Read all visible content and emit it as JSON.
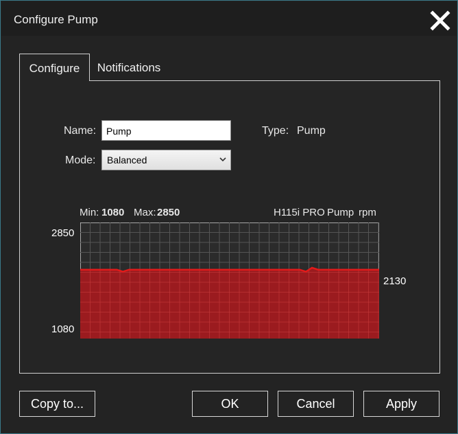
{
  "window": {
    "title": "Configure Pump"
  },
  "tabs": [
    {
      "label": "Configure",
      "active": true
    },
    {
      "label": "Notifications",
      "active": false
    }
  ],
  "form": {
    "name_label": "Name:",
    "name_value": "Pump",
    "mode_label": "Mode:",
    "mode_value": "Balanced",
    "type_label": "Type:",
    "type_value": "Pump"
  },
  "chart": {
    "min_label": "Min:",
    "min_value": "1080",
    "max_label": "Max:",
    "max_value": "2850",
    "device": "H115i PRO",
    "sensor": "Pump",
    "unit": "rpm",
    "y_top_label": "2850",
    "y_bottom_label": "1080",
    "current_label": "2130",
    "ylim": [
      1080,
      2850
    ],
    "current": 2130,
    "series_values": [
      2130,
      2130,
      2130,
      2130,
      2130,
      2130,
      2130,
      2100,
      2130,
      2130,
      2130,
      2130,
      2130,
      2130,
      2130,
      2130,
      2130,
      2130,
      2130,
      2130,
      2130,
      2130,
      2130,
      2130,
      2130,
      2130,
      2130,
      2130,
      2130,
      2130,
      2130,
      2130,
      2130,
      2130,
      2130,
      2130,
      2130,
      2100,
      2160,
      2130,
      2130,
      2130,
      2130,
      2130,
      2130,
      2130,
      2130,
      2130,
      2130,
      2130
    ],
    "line_color": "#e21a1a",
    "fill_color": "#9b1b1f"
  },
  "buttons": {
    "copy_to": "Copy to...",
    "ok": "OK",
    "cancel": "Cancel",
    "apply": "Apply"
  }
}
